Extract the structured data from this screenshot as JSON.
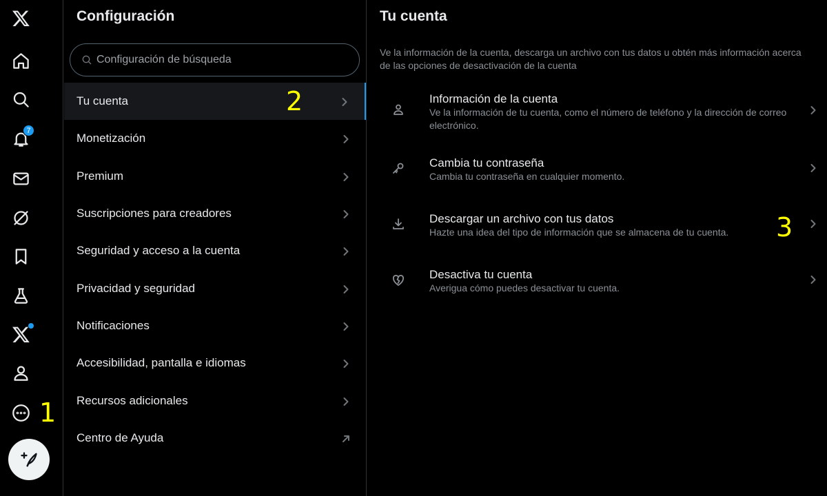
{
  "nav": {
    "items": [
      {
        "icon": "x-logo-icon"
      },
      {
        "icon": "home-icon"
      },
      {
        "icon": "search-icon"
      },
      {
        "icon": "bell-icon",
        "badge": "7"
      },
      {
        "icon": "mail-icon"
      },
      {
        "icon": "grok-icon"
      },
      {
        "icon": "bookmark-icon"
      },
      {
        "icon": "flask-icon"
      },
      {
        "icon": "x-premium-icon"
      },
      {
        "icon": "profile-icon"
      },
      {
        "icon": "more-icon"
      }
    ],
    "post_button_icon": "feather-plus-icon"
  },
  "annotations": {
    "one": "1",
    "two": "2",
    "three": "3"
  },
  "settings": {
    "title": "Configuración",
    "search_placeholder": "Configuración de búsqueda",
    "menu": [
      {
        "label": "Tu cuenta",
        "active": true
      },
      {
        "label": "Monetización"
      },
      {
        "label": "Premium"
      },
      {
        "label": "Suscripciones para creadores"
      },
      {
        "label": "Seguridad y acceso a la cuenta"
      },
      {
        "label": "Privacidad y seguridad"
      },
      {
        "label": "Notificaciones"
      },
      {
        "label": "Accesibilidad, pantalla e idiomas"
      },
      {
        "label": "Recursos adicionales"
      },
      {
        "label": "Centro de Ayuda",
        "external": true
      }
    ]
  },
  "account": {
    "title": "Tu cuenta",
    "description": "Ve la información de la cuenta, descarga un archivo con tus datos u obtén más información acerca de las opciones de desactivación de la cuenta",
    "items": [
      {
        "icon": "person-icon",
        "title": "Información de la cuenta",
        "subtitle": "Ve la información de tu cuenta, como el número de teléfono y la dirección de correo electrónico."
      },
      {
        "icon": "key-icon",
        "title": "Cambia tu contraseña",
        "subtitle": "Cambia tu contraseña en cualquier momento."
      },
      {
        "icon": "download-icon",
        "title": "Descargar un archivo con tus datos",
        "subtitle": "Hazte una idea del tipo de información que se almacena de tu cuenta."
      },
      {
        "icon": "broken-heart-icon",
        "title": "Desactiva tu cuenta",
        "subtitle": "Averigua cómo puedes desactivar tu cuenta."
      }
    ]
  },
  "colors": {
    "background": "#000000",
    "accent": "#1d9bf0",
    "annotation": "#ffff00",
    "text_primary": "#e7e9ea",
    "text_secondary": "#8b9096"
  }
}
